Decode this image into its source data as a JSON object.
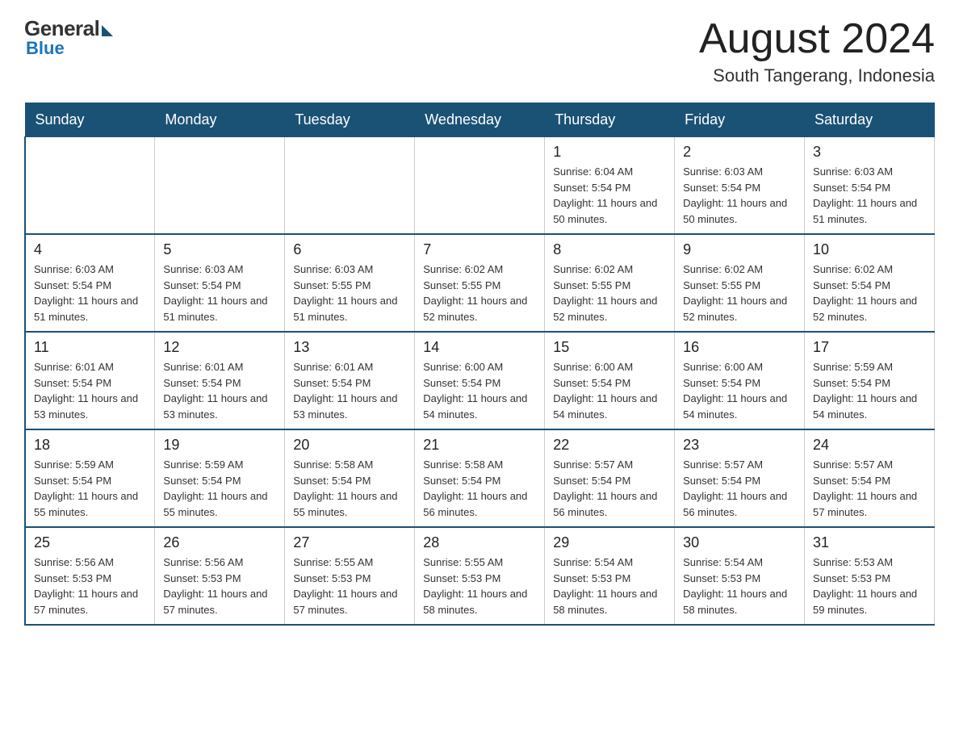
{
  "logo": {
    "general": "General",
    "blue": "Blue",
    "bottom": "Blue"
  },
  "title": {
    "month": "August 2024",
    "location": "South Tangerang, Indonesia"
  },
  "days_header": [
    "Sunday",
    "Monday",
    "Tuesday",
    "Wednesday",
    "Thursday",
    "Friday",
    "Saturday"
  ],
  "weeks": [
    [
      {
        "day": "",
        "info": ""
      },
      {
        "day": "",
        "info": ""
      },
      {
        "day": "",
        "info": ""
      },
      {
        "day": "",
        "info": ""
      },
      {
        "day": "1",
        "info": "Sunrise: 6:04 AM\nSunset: 5:54 PM\nDaylight: 11 hours and 50 minutes."
      },
      {
        "day": "2",
        "info": "Sunrise: 6:03 AM\nSunset: 5:54 PM\nDaylight: 11 hours and 50 minutes."
      },
      {
        "day": "3",
        "info": "Sunrise: 6:03 AM\nSunset: 5:54 PM\nDaylight: 11 hours and 51 minutes."
      }
    ],
    [
      {
        "day": "4",
        "info": "Sunrise: 6:03 AM\nSunset: 5:54 PM\nDaylight: 11 hours and 51 minutes."
      },
      {
        "day": "5",
        "info": "Sunrise: 6:03 AM\nSunset: 5:54 PM\nDaylight: 11 hours and 51 minutes."
      },
      {
        "day": "6",
        "info": "Sunrise: 6:03 AM\nSunset: 5:55 PM\nDaylight: 11 hours and 51 minutes."
      },
      {
        "day": "7",
        "info": "Sunrise: 6:02 AM\nSunset: 5:55 PM\nDaylight: 11 hours and 52 minutes."
      },
      {
        "day": "8",
        "info": "Sunrise: 6:02 AM\nSunset: 5:55 PM\nDaylight: 11 hours and 52 minutes."
      },
      {
        "day": "9",
        "info": "Sunrise: 6:02 AM\nSunset: 5:55 PM\nDaylight: 11 hours and 52 minutes."
      },
      {
        "day": "10",
        "info": "Sunrise: 6:02 AM\nSunset: 5:54 PM\nDaylight: 11 hours and 52 minutes."
      }
    ],
    [
      {
        "day": "11",
        "info": "Sunrise: 6:01 AM\nSunset: 5:54 PM\nDaylight: 11 hours and 53 minutes."
      },
      {
        "day": "12",
        "info": "Sunrise: 6:01 AM\nSunset: 5:54 PM\nDaylight: 11 hours and 53 minutes."
      },
      {
        "day": "13",
        "info": "Sunrise: 6:01 AM\nSunset: 5:54 PM\nDaylight: 11 hours and 53 minutes."
      },
      {
        "day": "14",
        "info": "Sunrise: 6:00 AM\nSunset: 5:54 PM\nDaylight: 11 hours and 54 minutes."
      },
      {
        "day": "15",
        "info": "Sunrise: 6:00 AM\nSunset: 5:54 PM\nDaylight: 11 hours and 54 minutes."
      },
      {
        "day": "16",
        "info": "Sunrise: 6:00 AM\nSunset: 5:54 PM\nDaylight: 11 hours and 54 minutes."
      },
      {
        "day": "17",
        "info": "Sunrise: 5:59 AM\nSunset: 5:54 PM\nDaylight: 11 hours and 54 minutes."
      }
    ],
    [
      {
        "day": "18",
        "info": "Sunrise: 5:59 AM\nSunset: 5:54 PM\nDaylight: 11 hours and 55 minutes."
      },
      {
        "day": "19",
        "info": "Sunrise: 5:59 AM\nSunset: 5:54 PM\nDaylight: 11 hours and 55 minutes."
      },
      {
        "day": "20",
        "info": "Sunrise: 5:58 AM\nSunset: 5:54 PM\nDaylight: 11 hours and 55 minutes."
      },
      {
        "day": "21",
        "info": "Sunrise: 5:58 AM\nSunset: 5:54 PM\nDaylight: 11 hours and 56 minutes."
      },
      {
        "day": "22",
        "info": "Sunrise: 5:57 AM\nSunset: 5:54 PM\nDaylight: 11 hours and 56 minutes."
      },
      {
        "day": "23",
        "info": "Sunrise: 5:57 AM\nSunset: 5:54 PM\nDaylight: 11 hours and 56 minutes."
      },
      {
        "day": "24",
        "info": "Sunrise: 5:57 AM\nSunset: 5:54 PM\nDaylight: 11 hours and 57 minutes."
      }
    ],
    [
      {
        "day": "25",
        "info": "Sunrise: 5:56 AM\nSunset: 5:53 PM\nDaylight: 11 hours and 57 minutes."
      },
      {
        "day": "26",
        "info": "Sunrise: 5:56 AM\nSunset: 5:53 PM\nDaylight: 11 hours and 57 minutes."
      },
      {
        "day": "27",
        "info": "Sunrise: 5:55 AM\nSunset: 5:53 PM\nDaylight: 11 hours and 57 minutes."
      },
      {
        "day": "28",
        "info": "Sunrise: 5:55 AM\nSunset: 5:53 PM\nDaylight: 11 hours and 58 minutes."
      },
      {
        "day": "29",
        "info": "Sunrise: 5:54 AM\nSunset: 5:53 PM\nDaylight: 11 hours and 58 minutes."
      },
      {
        "day": "30",
        "info": "Sunrise: 5:54 AM\nSunset: 5:53 PM\nDaylight: 11 hours and 58 minutes."
      },
      {
        "day": "31",
        "info": "Sunrise: 5:53 AM\nSunset: 5:53 PM\nDaylight: 11 hours and 59 minutes."
      }
    ]
  ]
}
